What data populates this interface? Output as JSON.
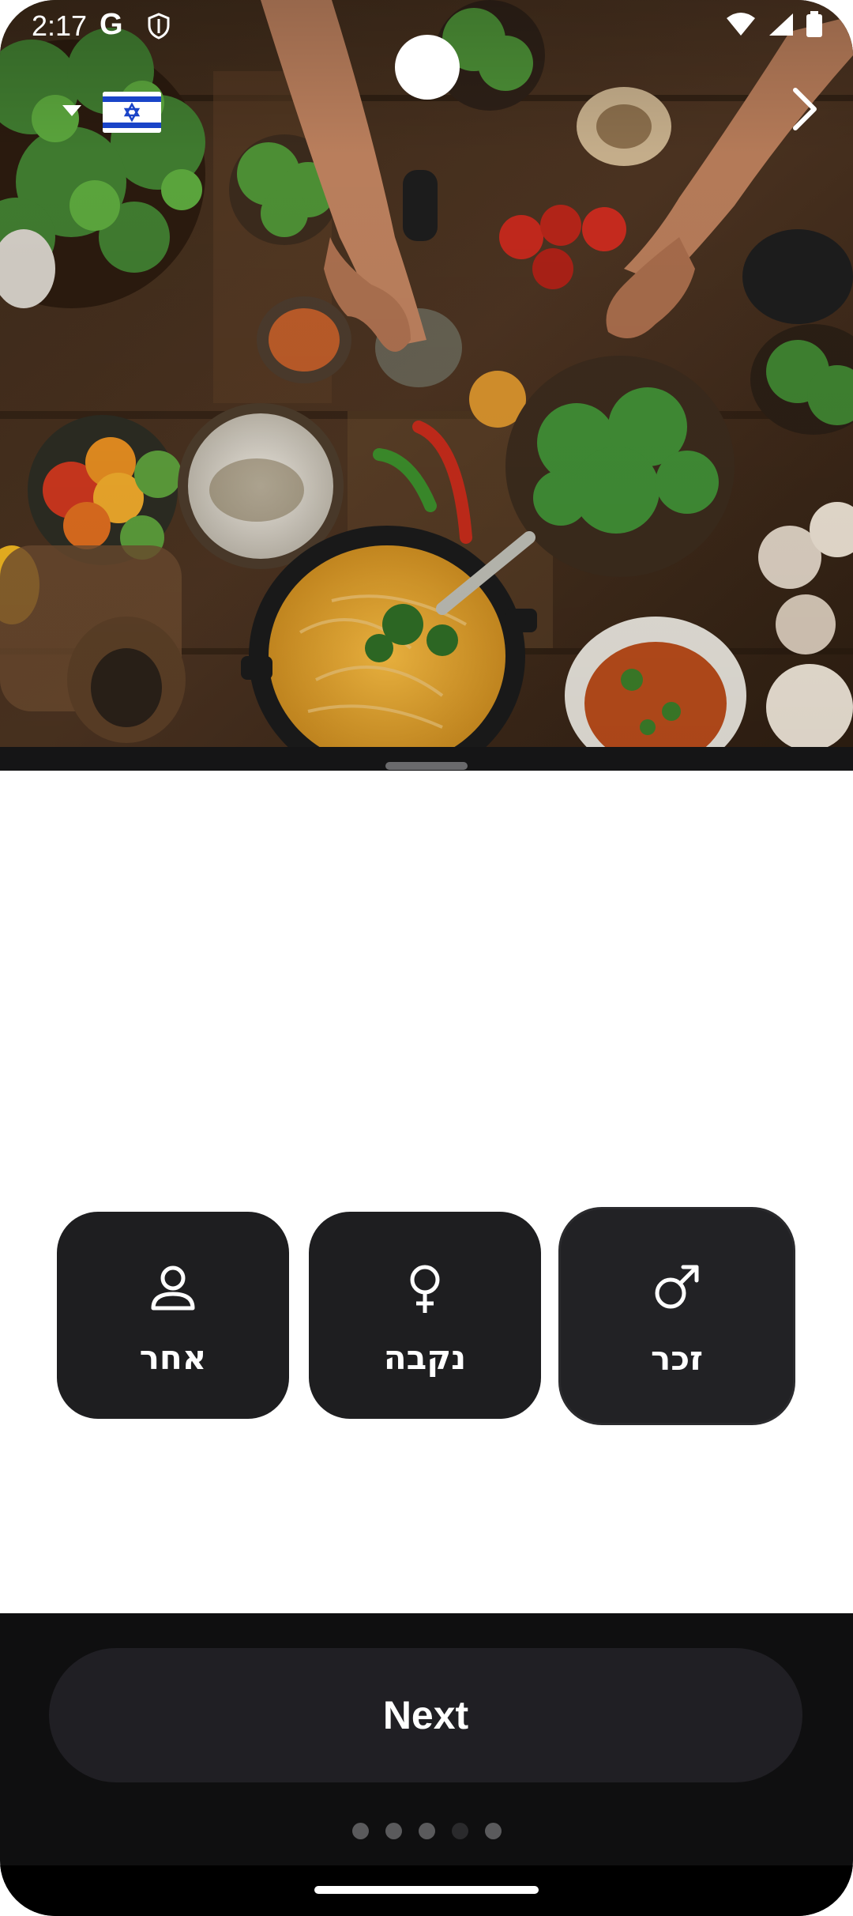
{
  "status_bar": {
    "time": "2:17",
    "google_indicator": "G",
    "icons": [
      "shield-icon",
      "wifi-icon",
      "signal-icon",
      "battery-icon"
    ]
  },
  "header": {
    "language_flag": "israel-flag",
    "language_dropdown_icon": "caret-down-icon",
    "next_icon": "chevron-right-icon"
  },
  "hero_image": {
    "subject": "cooking-table-photo"
  },
  "gender_options": [
    {
      "id": "other",
      "label": "אחר",
      "icon": "person-icon",
      "selected": false
    },
    {
      "id": "female",
      "label": "נקבה",
      "icon": "female-symbol-icon",
      "selected": false
    },
    {
      "id": "male",
      "label": "זכר",
      "icon": "male-symbol-icon",
      "selected": true
    }
  ],
  "footer": {
    "next_label": "Next",
    "page_count": 5,
    "current_page": 4
  },
  "colors": {
    "card_bg": "#1e1e20",
    "button_bg": "#201f24",
    "panel_bg": "#0f0f10",
    "dot_inactive": "#5a5a5c",
    "dot_active": "#2a2a2c"
  }
}
